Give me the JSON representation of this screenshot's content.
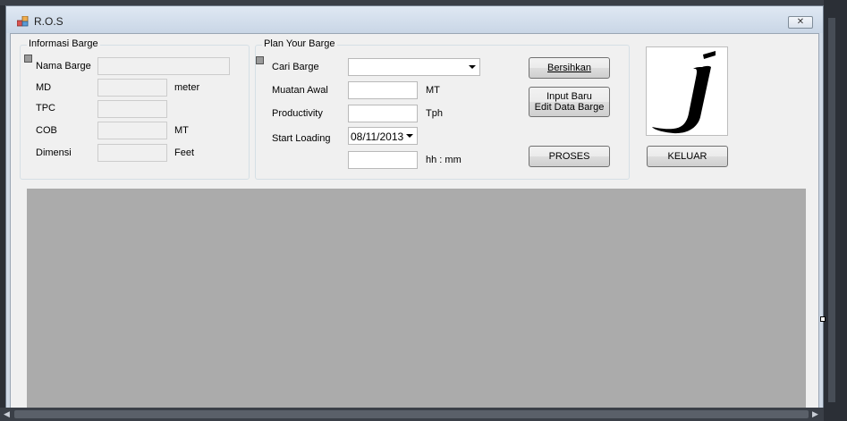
{
  "window": {
    "title": "R.O.S",
    "close_glyph": "✕"
  },
  "informasi": {
    "title": "Informasi Barge",
    "fields": {
      "nama_barge": {
        "label": "Nama Barge",
        "value": "",
        "unit": ""
      },
      "md": {
        "label": "MD",
        "value": "",
        "unit": "meter"
      },
      "tpc": {
        "label": "TPC",
        "value": "",
        "unit": ""
      },
      "cob": {
        "label": "COB",
        "value": "",
        "unit": "MT"
      },
      "dimensi": {
        "label": "Dimensi",
        "value": "",
        "unit": "Feet"
      }
    }
  },
  "plan": {
    "title": "Plan Your Barge",
    "cari_barge": {
      "label": "Cari Barge",
      "selected": ""
    },
    "muatan_awal": {
      "label": "Muatan Awal",
      "value": "",
      "unit": "MT"
    },
    "productivity": {
      "label": "Productivity",
      "value": "",
      "unit": "Tph"
    },
    "start_loading": {
      "label": "Start Loading",
      "date": "08/11/2013",
      "time": "",
      "time_unit": "hh : mm"
    }
  },
  "buttons": {
    "bersihkan": "Bersihkan",
    "input_baru_line1": "Input Baru",
    "input_baru_line2": "Edit Data Barge",
    "proses": "PROSES",
    "keluar": "KELUAR"
  },
  "logo": {
    "letter": "j"
  },
  "colors": {
    "panel_gray": "#ababab",
    "form_bg": "#f0f0f0",
    "titlebar": "#cfd9e6"
  }
}
